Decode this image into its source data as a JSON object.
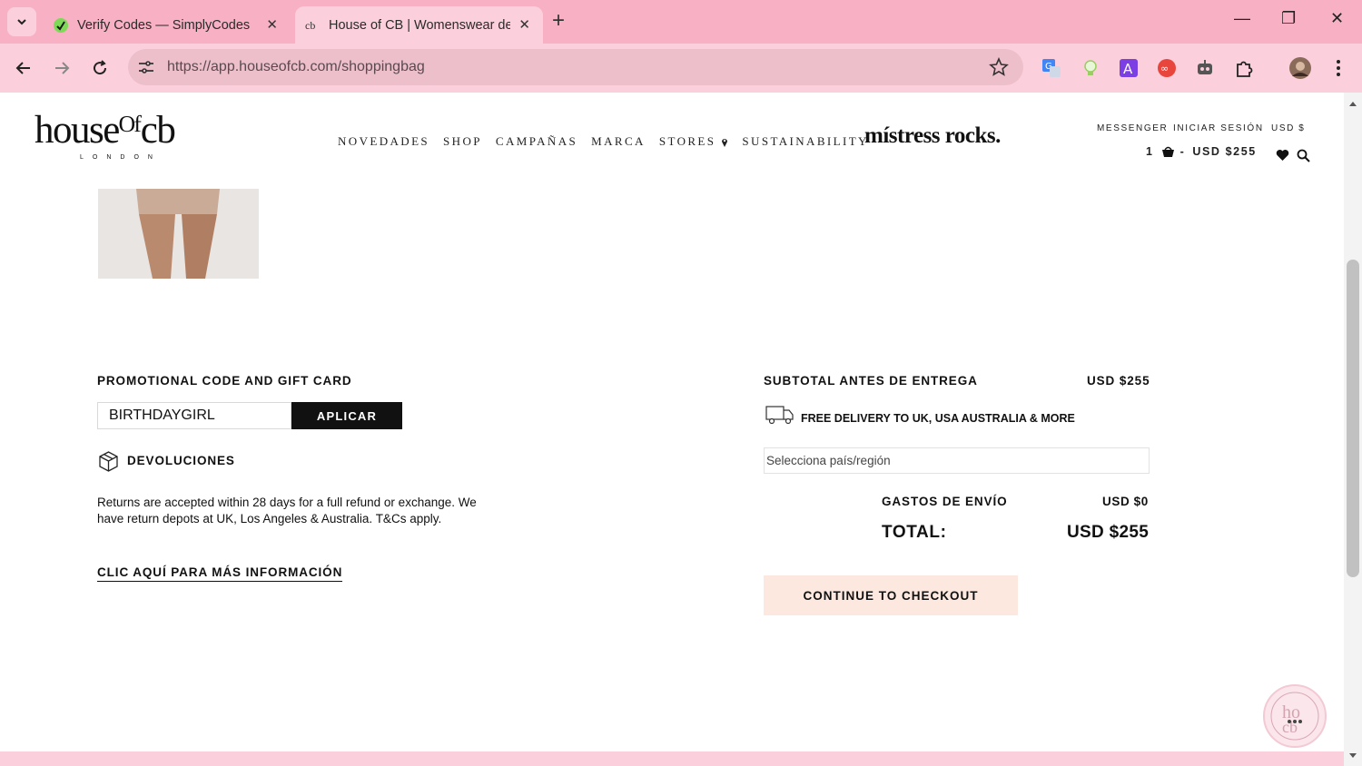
{
  "browser": {
    "tabs": [
      {
        "title": "Verify Codes — SimplyCodes",
        "icon": "simplycodes-icon",
        "active": false
      },
      {
        "title": "House of CB | Womenswear des",
        "icon": "houseofcb-icon",
        "active": true
      }
    ],
    "url": "https://app.houseofcb.com/shoppingbag"
  },
  "header": {
    "logo_main": "houseᴼᶠcb",
    "logo_sub": "LONDON",
    "nav": [
      "NOVEDADES",
      "SHOP",
      "CAMPAÑAS",
      "MARCA",
      "STORES",
      "SUSTAINABILITY"
    ],
    "promo_brand": "místress rocks.",
    "util": {
      "messenger": "MESSENGER",
      "login": "INICIAR SESIÓN",
      "currency": "USD $"
    },
    "bag": {
      "count": "1",
      "sep": "-",
      "total": "USD $255"
    }
  },
  "promo": {
    "heading": "PROMOTIONAL CODE AND GIFT CARD",
    "code_value": "BIRTHDAYGIRL",
    "apply_label": "APLICAR"
  },
  "returns": {
    "heading": "DEVOLUCIONES",
    "text": "Returns are accepted within 28 days for a full refund or exchange. We have return depots at UK, Los Angeles & Australia. T&Cs apply.",
    "link": "CLIC AQUÍ PARA MÁS INFORMACIÓN"
  },
  "summary": {
    "subtotal_label": "SUBTOTAL ANTES DE ENTREGA",
    "subtotal_value": "USD $255",
    "delivery_text": "FREE DELIVERY TO UK, USA AUSTRALIA & MORE",
    "country_placeholder": "Selecciona país/región",
    "shipping_label": "GASTOS DE ENVÍO",
    "shipping_value": "USD $0",
    "total_label": "TOTAL:",
    "total_value": "USD $255",
    "checkout_label": "CONTINUE TO CHECKOUT"
  },
  "colors": {
    "chrome": "#f8b0c4",
    "toolbar": "#fbd0dc",
    "checkout_bg": "#fde8e0"
  }
}
